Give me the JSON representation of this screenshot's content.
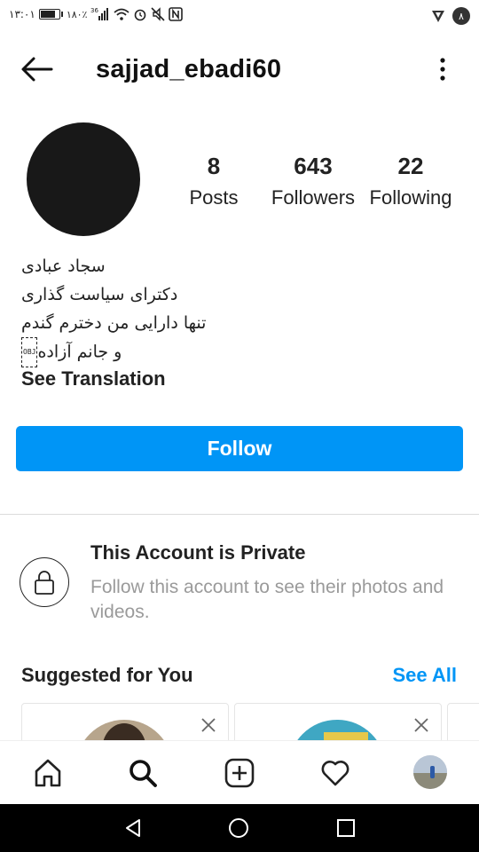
{
  "status_bar": {
    "time": "۱۳:۰۱",
    "battery_pct": "۱۸۰٪",
    "signal_label": "36",
    "right_badge": "۸"
  },
  "header": {
    "username": "sajjad_ebadi60"
  },
  "profile": {
    "stats": {
      "posts_count": "8",
      "posts_label": "Posts",
      "followers_count": "643",
      "followers_label": "Followers",
      "following_count": "22",
      "following_label": "Following"
    },
    "bio": {
      "line1": "سجاد عبادی",
      "line2": "دکترای سیاست گذاری",
      "line3": "تنها دارایی من دخترم گندم",
      "line4": "و جانم آزاده",
      "obj_glyph": "OBJ"
    },
    "see_translation": "See Translation",
    "follow_button": "Follow"
  },
  "private": {
    "title": "This Account is Private",
    "description": "Follow this account to see their photos and videos."
  },
  "suggested": {
    "title": "Suggested for You",
    "see_all": "See All"
  },
  "colors": {
    "accent": "#0095f6",
    "muted_text": "#9a9a9a",
    "divider": "#dbdbdb"
  },
  "icons": {
    "back": "arrow-left-icon",
    "more": "more-vertical-icon",
    "lock": "lock-icon",
    "close": "close-icon",
    "home": "home-icon",
    "search": "search-icon",
    "add": "add-post-icon",
    "heart": "heart-icon",
    "profile": "profile-avatar-icon"
  }
}
